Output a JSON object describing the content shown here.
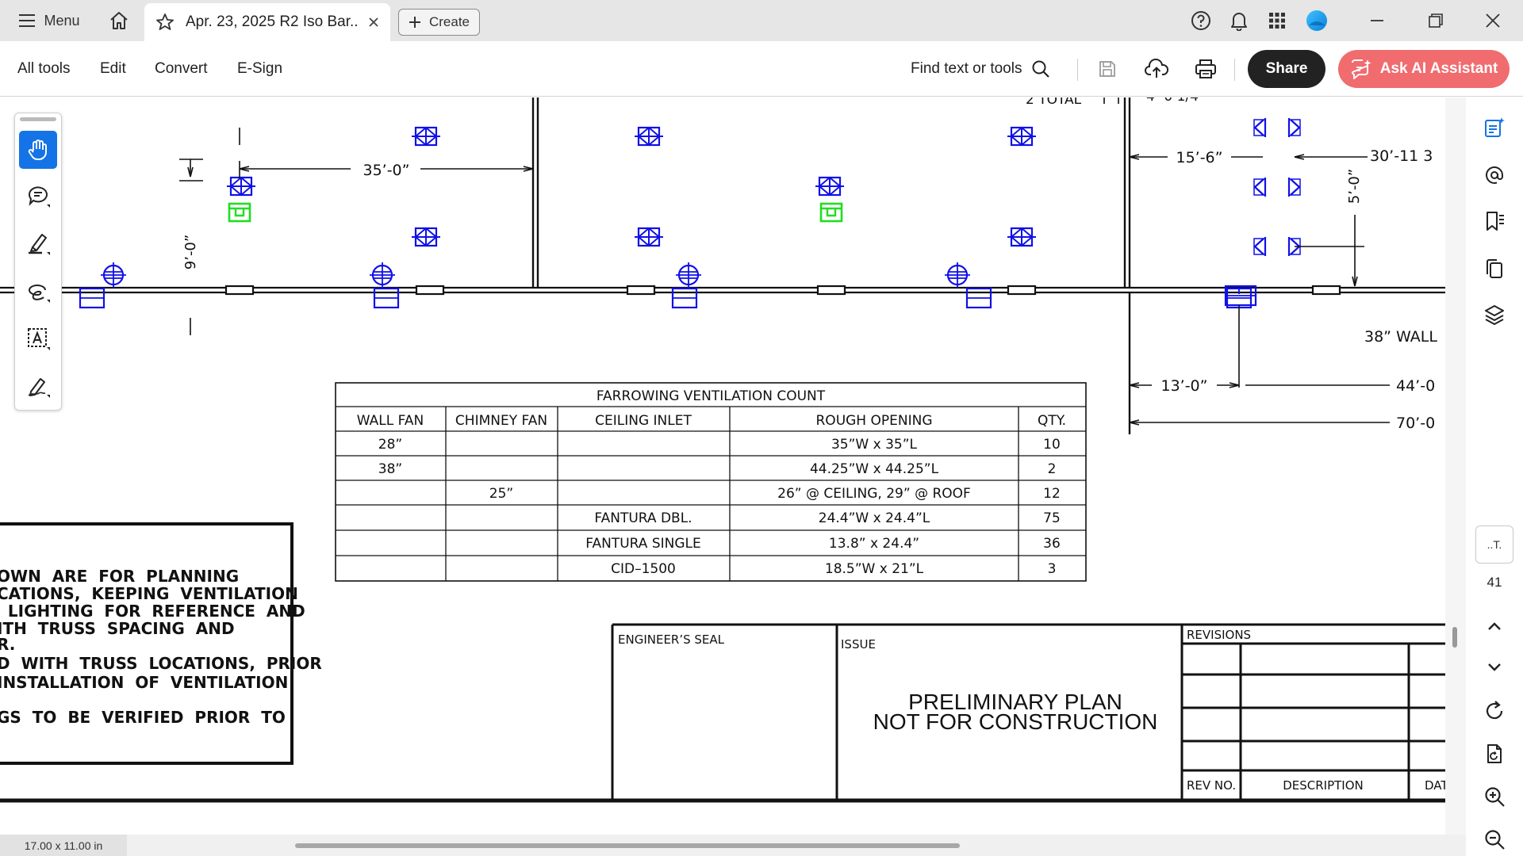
{
  "app": {
    "menu_label": "Menu",
    "tab_title": "Apr. 23, 2025 R2 Iso Bar...",
    "create_label": "Create"
  },
  "toolbar": {
    "all_tools": "All tools",
    "edit": "Edit",
    "convert": "Convert",
    "esign": "E-Sign",
    "find_placeholder": "Find text or tools",
    "share": "Share",
    "ai_assistant": "Ask AI Assistant"
  },
  "drawing": {
    "dim_35": "35’-0”",
    "dim_9": "9’-0”",
    "dim_15_6": "15’-6”",
    "dim_30_11": "30’-11  3",
    "dim_5": "5’-0”",
    "dim_13": "13’-0”",
    "dim_44": "44’-0",
    "dim_70": "70’-0",
    "label_38_wall": "38”  WALL",
    "partial_top_left": "2  TOTAL",
    "partial_top_right": "4’-0 1/4”"
  },
  "table": {
    "title": "FARROWING  VENTILATION  COUNT",
    "headers": [
      "WALL  FAN",
      "CHIMNEY  FAN",
      "CEILING  INLET",
      "ROUGH  OPENING",
      "QTY."
    ],
    "rows": [
      [
        "28”",
        "",
        "",
        "35”W  x  35”L",
        "10"
      ],
      [
        "38”",
        "",
        "",
        "44.25”W  x  44.25”L",
        "2"
      ],
      [
        "",
        "25”",
        "",
        "26”  @  CEILING,  29”  @  ROOF",
        "12"
      ],
      [
        "",
        "",
        "FANTURA  DBL.",
        "24.4”W  x  24.4”L",
        "75"
      ],
      [
        "",
        "",
        "FANTURA  SINGLE",
        "13.8”  x  24.4”",
        "36"
      ],
      [
        "",
        "",
        "CID–1500",
        "18.5”W  x  21”L",
        "3"
      ]
    ]
  },
  "notes": {
    "lines": [
      "OWN  ARE  FOR  PLANNING",
      "CATIONS,  KEEPING  VENTILATION",
      "  LIGHTING  FOR  REFERENCE  AND",
      "ITH  TRUSS  SPACING  AND",
      "R.",
      "D  WITH  TRUSS  LOCATIONS,  PRIOR",
      "INSTALLATION  OF  VENTILATION",
      "GS  TO  BE  VERIFIED  PRIOR  TO"
    ]
  },
  "title_block": {
    "engineers_seal": "ENGINEER’S  SEAL",
    "issue": "ISSUE",
    "status_line1": "PRELIMINARY PLAN",
    "status_line2": "NOT FOR CONSTRUCTION",
    "revisions": "REVISIONS",
    "rev_no": "REV  NO.",
    "description": "DESCRIPTION",
    "date": "DAT"
  },
  "sidebar": {
    "page_thumb_label": "..T.",
    "page_number": "41"
  },
  "status": {
    "page_size": "17.00 x 11.00 in"
  },
  "colors": {
    "accent": "#1473e6",
    "ai_button": "#f06c6f",
    "cad_blue": "#1010e8",
    "cad_green": "#22dd22",
    "cad_red": "#e8104a"
  }
}
